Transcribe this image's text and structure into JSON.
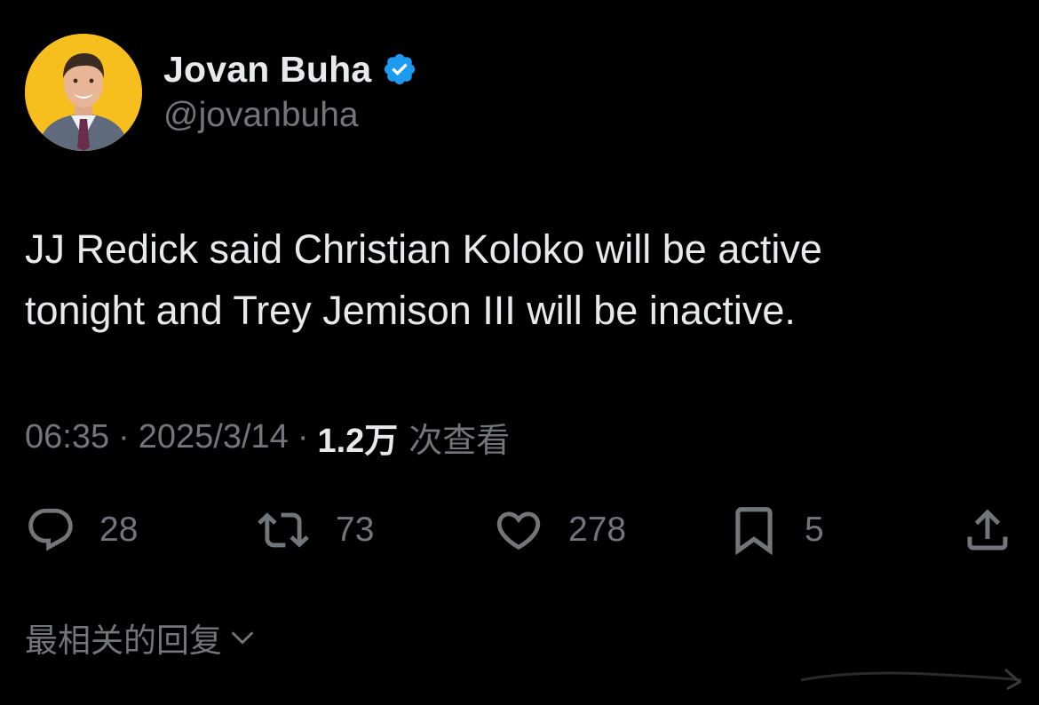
{
  "author": {
    "display_name": "Jovan Buha",
    "handle": "@jovanbuha",
    "verified_icon": "verified-badge-icon",
    "avatar_bg_color": "#f7bf1e"
  },
  "tweet": {
    "text_lines": [
      "JJ Redick said Christian Koloko will be active",
      "tonight and Trey Jemison III will be inactive."
    ]
  },
  "meta": {
    "time": "06:35",
    "separator": "·",
    "date": "2025/3/14",
    "views_count": "1.2万",
    "views_label": "次查看"
  },
  "actions": {
    "reply": {
      "icon": "reply-icon",
      "count": "28"
    },
    "retweet": {
      "icon": "retweet-icon",
      "count": "73"
    },
    "like": {
      "icon": "heart-icon",
      "count": "278"
    },
    "bookmark": {
      "icon": "bookmark-icon",
      "count": "5"
    },
    "share": {
      "icon": "share-icon"
    }
  },
  "replies_sort": {
    "label": "最相关的回复",
    "icon": "chevron-down-icon"
  },
  "colors": {
    "background": "#000000",
    "primary_text": "#e7e9ea",
    "secondary_text": "#71767b",
    "verified_blue": "#1d9bf0"
  }
}
